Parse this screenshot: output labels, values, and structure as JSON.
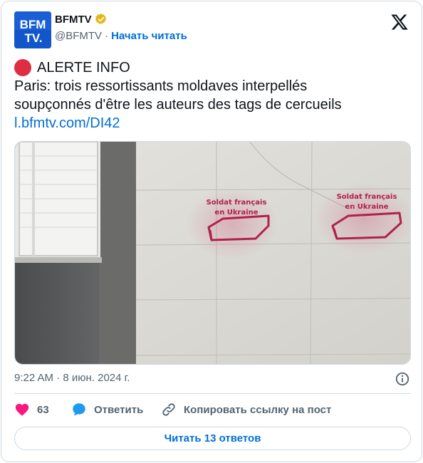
{
  "account": {
    "avatar_text_top": "BFM",
    "avatar_text_bottom": "TV.",
    "display_name": "BFMTV",
    "handle": "@BFMTV",
    "separator": "·",
    "follow_label": "Начать читать",
    "verified_badge_color": "#e2b719"
  },
  "tweet": {
    "alert_label": "ALERTE INFO",
    "body_line_1": "Paris: trois ressortissants moldaves interpellés",
    "body_line_2": "soupçonnés d'être les auteurs des tags de cercueils",
    "link": "l.bfmtv.com/DI42",
    "timestamp": "9:22 AM · 8 июн. 2024 г."
  },
  "image": {
    "tag_line_1": "Soldat français",
    "tag_line_2": "en Ukraine"
  },
  "actions": {
    "like_count": "63",
    "reply_label": "Ответить",
    "copy_link_label": "Копировать ссылку на пост"
  },
  "replies_button_label": "Читать 13 ответов",
  "colors": {
    "link": "#006fd6",
    "heart": "#f91880",
    "reply_bubble": "#1d9bf0",
    "alert_dot": "#dd2e44",
    "avatar_bg": "#1356c9",
    "border": "#cfd9de"
  }
}
